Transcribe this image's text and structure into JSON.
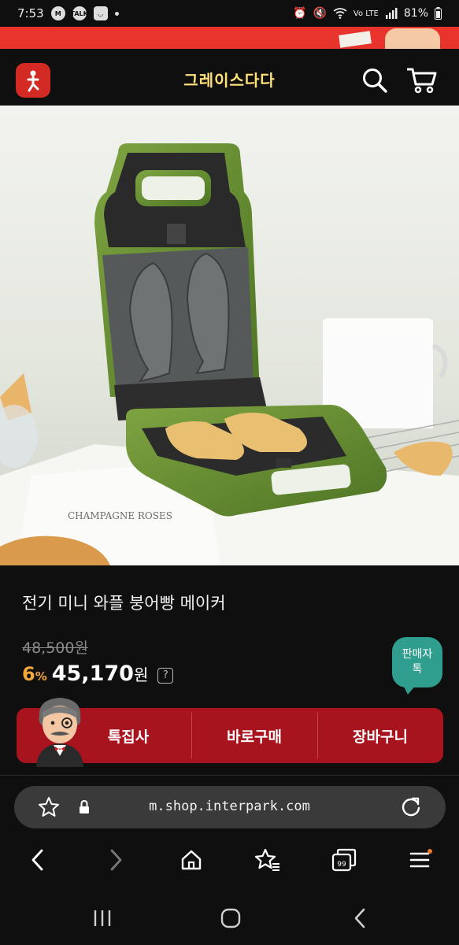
{
  "status_bar": {
    "time": "7:53",
    "notif_icons": [
      "gmail-icon",
      "kakaotalk-icon",
      "chat-face-icon"
    ],
    "network": "Vo LTE",
    "battery": "81%"
  },
  "header": {
    "site_title": "그레이스다다",
    "icons": [
      "logo-icon",
      "search-icon",
      "cart-icon"
    ]
  },
  "product": {
    "title": "전기 미니 와플 붕어빵 메이커",
    "original_price": "48,500원",
    "discount_value": "6",
    "discount_unit": "%",
    "price": "45,170",
    "price_unit": "원",
    "help_mark": "?",
    "image_text": "CHAMPAGNE ROSES"
  },
  "seller_chat": {
    "line1": "판매자",
    "line2": "톡"
  },
  "actions": {
    "talk_label": "톡집사",
    "buy_label": "바로구매",
    "cart_label": "장바구니"
  },
  "browser": {
    "url": "m.shop.interpark.com",
    "tab_count": "99"
  },
  "colors": {
    "accent_red": "#a8141d",
    "title_yellow": "#ffe17a",
    "discount_orange": "#f3a83a",
    "chat_teal": "#2f9e8e"
  }
}
